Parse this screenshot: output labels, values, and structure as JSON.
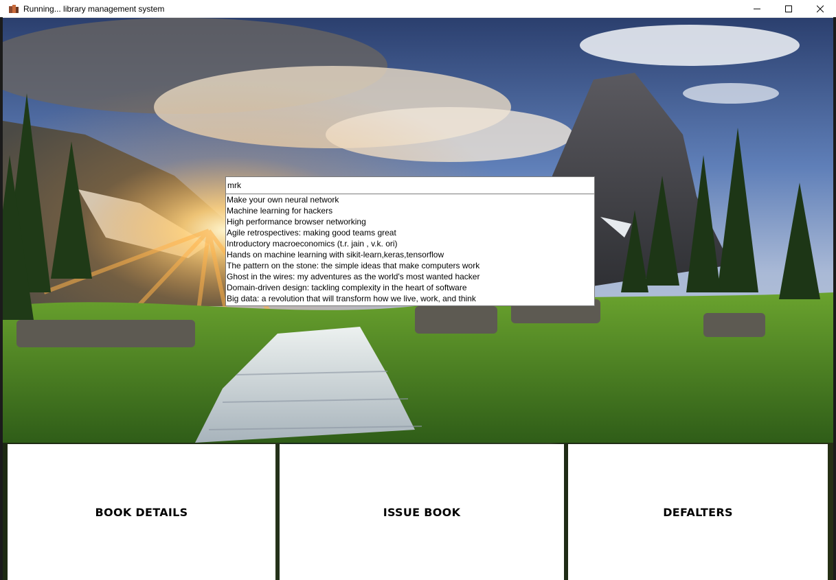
{
  "window": {
    "title": "Running... library management system",
    "controls": {
      "minimize": "—",
      "maximize": "☐",
      "close": "✕"
    }
  },
  "search": {
    "value": "mrk",
    "suggestions": [
      "Make your own neural network",
      "Machine learning for hackers",
      "High performance browser networking",
      "Agile retrospectives: making good teams great",
      "Introductory macroeconomics (t.r. jain , v.k. ori)",
      "Hands on machine learning with sikit-learn,keras,tensorflow",
      "The pattern on the stone: the simple ideas that make computers work",
      "Ghost in the wires: my adventures as the world's most wanted hacker",
      "Domain-driven design: tackling complexity in the heart of software",
      "Big data: a revolution that will transform how we live, work, and think"
    ]
  },
  "cards": {
    "book_details": "BOOK DETAILS",
    "issue_book": "ISSUE BOOK",
    "defalters": "DEFALTERS"
  },
  "colors": {
    "sky_top": "#2f4d8c",
    "sky_mid": "#6f8fc4",
    "sun": "#ffd27a",
    "grass": "#4f8a25",
    "rock": "#4a4a50",
    "water": "#dfe7ef"
  }
}
